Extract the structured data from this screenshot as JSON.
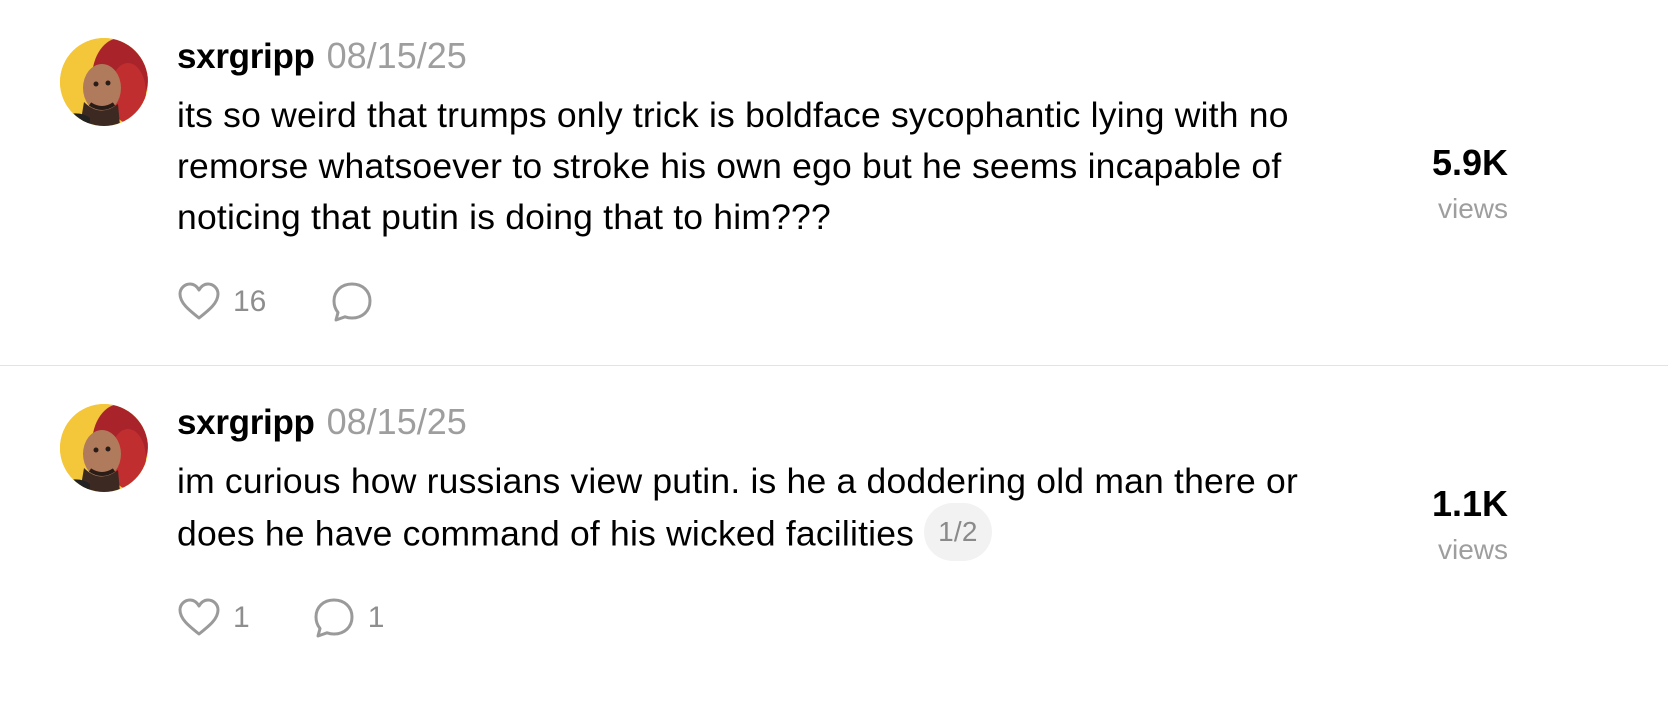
{
  "posts": [
    {
      "username": "sxrgripp",
      "date": "08/15/25",
      "text": "its so weird that trumps only trick is boldface sycophantic lying with no remorse whatsoever to stroke his own ego but he seems incapable of noticing that putin is doing that to him???",
      "thread_badge": "",
      "likes": "16",
      "replies": "",
      "views": "5.9K",
      "views_label": "views"
    },
    {
      "username": "sxrgripp",
      "date": "08/15/25",
      "text": "im curious how russians view putin. is he a doddering old man there or does he have command of his wicked facilities",
      "thread_badge": "1/2",
      "likes": "1",
      "replies": "1",
      "views": "1.1K",
      "views_label": "views"
    }
  ],
  "icons": {
    "like": "heart-icon",
    "reply": "comment-bubble-icon"
  },
  "colors": {
    "text": "#000000",
    "muted": "#9e9e9e",
    "divider": "#e3e3e3",
    "avatar_bg": "#f4c63a",
    "hair": "#b3262a"
  }
}
